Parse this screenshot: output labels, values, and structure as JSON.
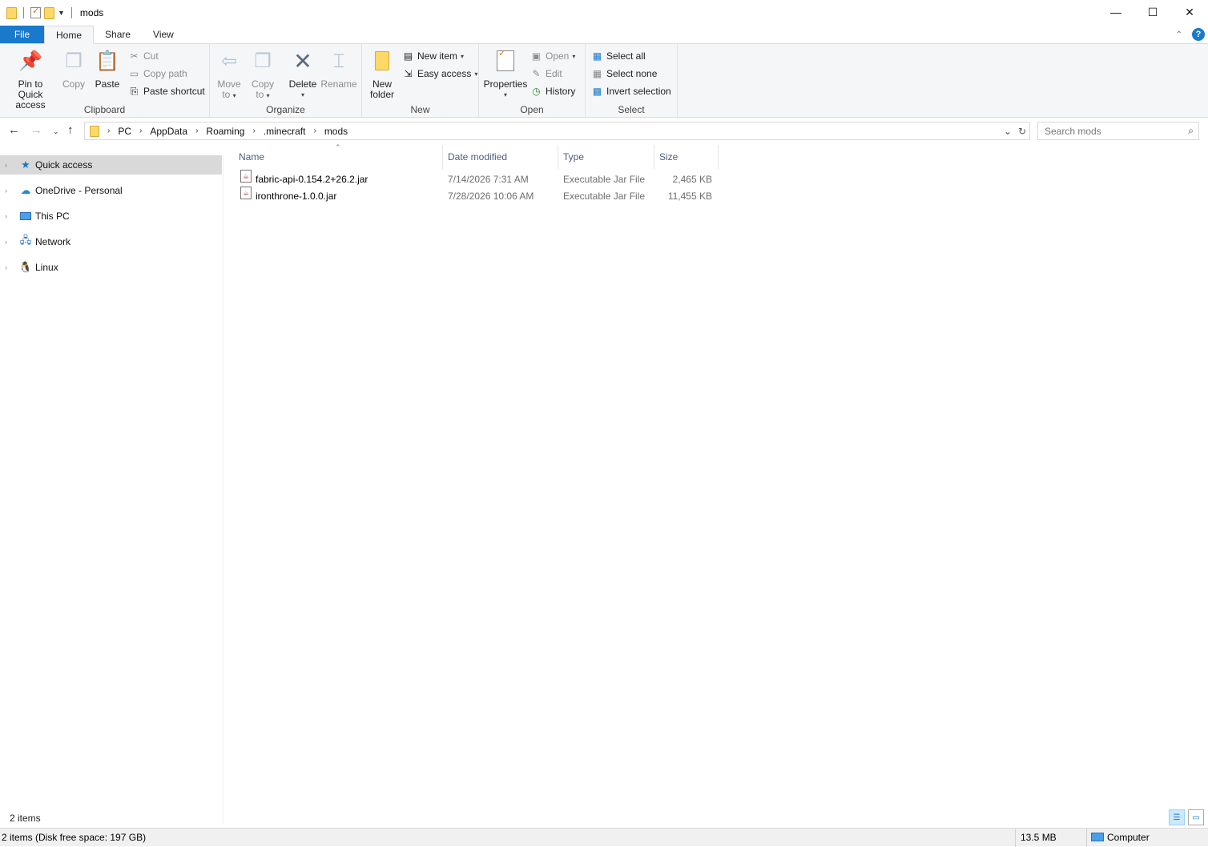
{
  "window": {
    "title": "mods",
    "minimize_glyph": "—",
    "maximize_glyph": "☐",
    "close_glyph": "✕"
  },
  "tabs": [
    {
      "label": "File"
    },
    {
      "label": "Home"
    },
    {
      "label": "Share"
    },
    {
      "label": "View"
    }
  ],
  "help_label": "?",
  "ribbon": {
    "clipboard": {
      "label": "Clipboard",
      "pin_label_1": "Pin to Quick",
      "pin_label_2": "access",
      "copy_label": "Copy",
      "paste_label": "Paste",
      "cut_label": "Cut",
      "copy_path_label": "Copy path",
      "paste_shortcut_label": "Paste shortcut"
    },
    "organize": {
      "label": "Organize",
      "move_label_1": "Move",
      "move_label_2": "to",
      "copyto_label_1": "Copy",
      "copyto_label_2": "to",
      "delete_label": "Delete",
      "rename_label": "Rename"
    },
    "new": {
      "label": "New",
      "new_folder_label_1": "New",
      "new_folder_label_2": "folder",
      "new_item_label": "New item",
      "easy_access_label": "Easy access"
    },
    "open": {
      "label": "Open",
      "properties_label": "Properties",
      "open_label": "Open",
      "edit_label": "Edit",
      "history_label": "History"
    },
    "select": {
      "label": "Select",
      "select_all_label": "Select all",
      "select_none_label": "Select none",
      "invert_label": "Invert selection"
    }
  },
  "address": {
    "crumbs": [
      "PC",
      "AppData",
      "Roaming",
      ".minecraft",
      "mods"
    ]
  },
  "search": {
    "placeholder": "Search mods"
  },
  "nav_pane": {
    "items": [
      {
        "label": "Quick access",
        "icon": "star-icon"
      },
      {
        "label": "OneDrive - Personal",
        "icon": "cloud-icon"
      },
      {
        "label": "This PC",
        "icon": "monitor-icon"
      },
      {
        "label": "Network",
        "icon": "network-icon"
      },
      {
        "label": "Linux",
        "icon": "penguin-icon"
      }
    ]
  },
  "columns": {
    "name": "Name",
    "date": "Date modified",
    "type": "Type",
    "size": "Size"
  },
  "files": [
    {
      "name": "fabric-api-0.154.2+26.2.jar",
      "date": "7/14/2026 7:31 AM",
      "type": "Executable Jar File",
      "size": "2,465 KB"
    },
    {
      "name": "ironthrone-1.0.0.jar",
      "date": "7/28/2026 10:06 AM",
      "type": "Executable Jar File",
      "size": "11,455 KB"
    }
  ],
  "status": {
    "items_count": "2 items",
    "disk_free": "2 items (Disk free space: 197 GB)",
    "total_size": "13.5 MB",
    "location": "Computer"
  },
  "colors": {
    "accent": "#1979ca",
    "ribbon_bg": "#f5f6f7",
    "selection": "#d9d9d9"
  }
}
